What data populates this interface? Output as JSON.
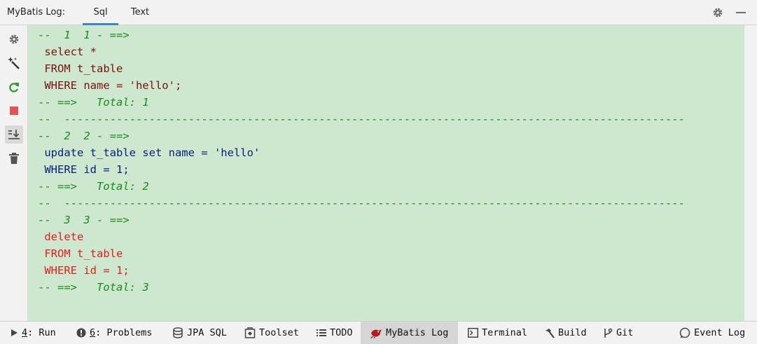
{
  "header": {
    "title": "MyBatis Log:",
    "tabs": [
      {
        "label": "Sql",
        "active": true
      },
      {
        "label": "Text",
        "active": false
      }
    ]
  },
  "toolbar": {
    "icons": [
      "gear-icon",
      "magic-wand-icon",
      "rerun-icon",
      "stop-icon",
      "scroll-to-end-icon",
      "trash-icon"
    ]
  },
  "log": {
    "lines": [
      {
        "text": "--  1  1 - ==>",
        "kind": "comment"
      },
      {
        "text": " select *",
        "kind": "select"
      },
      {
        "text": " FROM t_table",
        "kind": "select"
      },
      {
        "text": " WHERE name = 'hello';",
        "kind": "select"
      },
      {
        "text": "-- ==>   Total: 1",
        "kind": "comment"
      },
      {
        "text": "--  -----------------------------------------------------------------------------------------------",
        "kind": "comment"
      },
      {
        "text": "--  2  2 - ==>",
        "kind": "comment"
      },
      {
        "text": " update t_table set name = 'hello'",
        "kind": "update"
      },
      {
        "text": " WHERE id = 1;",
        "kind": "update"
      },
      {
        "text": "-- ==>   Total: 2",
        "kind": "comment"
      },
      {
        "text": "--  -----------------------------------------------------------------------------------------------",
        "kind": "comment"
      },
      {
        "text": "--  3  3 - ==>",
        "kind": "comment"
      },
      {
        "text": " delete",
        "kind": "delete"
      },
      {
        "text": " FROM t_table",
        "kind": "delete"
      },
      {
        "text": " WHERE id = 1;",
        "kind": "delete"
      },
      {
        "text": "-- ==>   Total: 3",
        "kind": "comment"
      }
    ]
  },
  "statusbar": {
    "run": {
      "num": "4",
      "label": ": Run"
    },
    "problems": {
      "num": "6",
      "label": ": Problems"
    },
    "jpa_sql": "JPA SQL",
    "toolset": "Toolset",
    "todo": "TODO",
    "mybatis_log": "MyBatis Log",
    "terminal": "Terminal",
    "build": "Build",
    "git": "Git",
    "event_log": "Event Log"
  },
  "colors": {
    "log_background": "#cde8cf",
    "comment": "#1a8c1a",
    "select": "#7a1010",
    "update": "#0a1f7c",
    "delete": "#e01e1e",
    "tab_underline": "#4083c9"
  }
}
